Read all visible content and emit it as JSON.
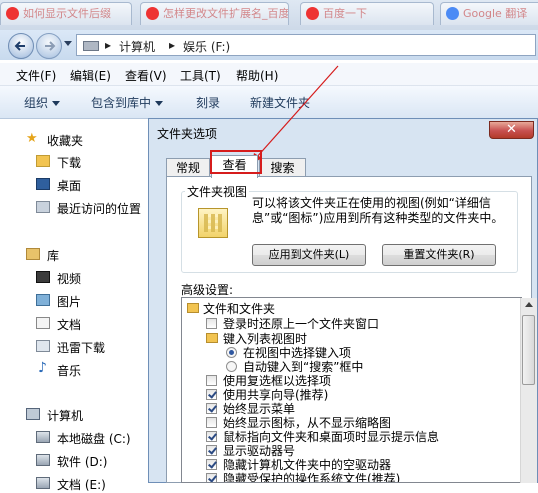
{
  "browser_tabs": [
    {
      "label": "如何显示文件后缀"
    },
    {
      "label": "怎样更改文件扩展名_百度经验"
    },
    {
      "label": "百度一下"
    },
    {
      "label": "Google 翻译"
    }
  ],
  "address": {
    "segments": [
      "计算机",
      "娱乐 (F:)"
    ],
    "separator": "▸"
  },
  "menu": [
    "文件(F)",
    "编辑(E)",
    "查看(V)",
    "工具(T)",
    "帮助(H)"
  ],
  "toolbar": {
    "organize": "组织",
    "include": "包含到库中",
    "burn": "刻录",
    "new_folder": "新建文件夹"
  },
  "nav": {
    "favorites": "收藏夹",
    "downloads": "下载",
    "desktop": "桌面",
    "recent": "最近访问的位置",
    "libraries": "库",
    "videos": "视频",
    "pictures": "图片",
    "documents": "文档",
    "thunder": "迅雷下载",
    "music": "音乐",
    "computer": "计算机",
    "drive_c": "本地磁盘 (C:)",
    "drive_d": "软件 (D:)",
    "drive_e": "文档 (E:)"
  },
  "dialog": {
    "title": "文件夹选项",
    "close_glyph": "✕",
    "tabs": [
      "常规",
      "查看",
      "搜索"
    ],
    "folder_views_legend": "文件夹视图",
    "folder_views_desc": "可以将该文件夹正在使用的视图(例如“详细信息”或“图标”)应用到所有这种类型的文件夹中。",
    "apply_button": "应用到文件夹(L)",
    "reset_button": "重置文件夹(R)",
    "advanced_label": "高级设置:",
    "tree": [
      {
        "kind": "folder",
        "label": "文件和文件夹"
      },
      {
        "kind": "check",
        "checked": false,
        "label": "登录时还原上一个文件夹窗口"
      },
      {
        "kind": "folder",
        "label": "键入列表视图时"
      },
      {
        "kind": "radio",
        "checked": true,
        "label": "在视图中选择键入项"
      },
      {
        "kind": "radio",
        "checked": false,
        "label": "自动键入到“搜索”框中"
      },
      {
        "kind": "check",
        "checked": false,
        "label": "使用复选框以选择项"
      },
      {
        "kind": "check",
        "checked": true,
        "label": "使用共享向导(推荐)"
      },
      {
        "kind": "check",
        "checked": true,
        "label": "始终显示菜单"
      },
      {
        "kind": "check",
        "checked": false,
        "label": "始终显示图标，从不显示缩略图"
      },
      {
        "kind": "check",
        "checked": true,
        "label": "鼠标指向文件夹和桌面项时显示提示信息"
      },
      {
        "kind": "check",
        "checked": true,
        "label": "显示驱动器号"
      },
      {
        "kind": "check",
        "checked": true,
        "label": "隐藏计算机文件夹中的空驱动器"
      },
      {
        "kind": "check",
        "checked": true,
        "label": "隐藏受保护的操作系统文件(推荐)"
      }
    ]
  },
  "colors": {
    "highlight_box": "#d61c1c",
    "arrow": "#d61c1c"
  }
}
